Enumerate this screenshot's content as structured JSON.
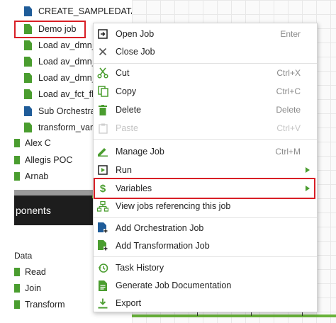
{
  "tree": {
    "items": [
      {
        "label": "CREATE_SAMPLEDATA_TABLE",
        "icon": "blue-file-icon",
        "color": "#1f5c99"
      },
      {
        "label": "Demo job",
        "icon": "green-file-icon",
        "color": "#4a9d2f"
      },
      {
        "label": "Load av_dmn_air",
        "icon": "green-file-icon",
        "color": "#4a9d2f"
      },
      {
        "label": "Load av_dmn_air",
        "icon": "green-file-icon",
        "color": "#4a9d2f"
      },
      {
        "label": "Load av_dmn_dat",
        "icon": "green-file-icon",
        "color": "#4a9d2f"
      },
      {
        "label": "Load av_fct_fligh",
        "icon": "green-file-icon",
        "color": "#4a9d2f"
      },
      {
        "label": "Sub Orchestration",
        "icon": "blue-file-icon",
        "color": "#1f5c99"
      },
      {
        "label": "transform_variab",
        "icon": "green-file-icon",
        "color": "#4a9d2f"
      }
    ],
    "folders": [
      "Alex C",
      "Allegis POC",
      "Arnab"
    ]
  },
  "components_panel": {
    "title": "ponents",
    "section": "Data",
    "items": [
      "Read",
      "Join",
      "Transform"
    ]
  },
  "context_menu": {
    "items": [
      {
        "label": "Open Job",
        "shortcut": "Enter",
        "icon": "open-job-icon",
        "disabled": false
      },
      {
        "label": "Close Job",
        "shortcut": "",
        "icon": "close-icon",
        "disabled": false
      },
      {
        "label": "Cut",
        "shortcut": "Ctrl+X",
        "icon": "scissors-icon",
        "disabled": false
      },
      {
        "label": "Copy",
        "shortcut": "Ctrl+C",
        "icon": "copy-icon",
        "disabled": false
      },
      {
        "label": "Delete",
        "shortcut": "Delete",
        "icon": "trash-icon",
        "disabled": false
      },
      {
        "label": "Paste",
        "shortcut": "Ctrl+V",
        "icon": "paste-icon",
        "disabled": true
      },
      {
        "label": "Manage Job",
        "shortcut": "Ctrl+M",
        "icon": "pencil-icon",
        "disabled": false
      },
      {
        "label": "Run",
        "shortcut": "",
        "icon": "run-icon",
        "disabled": false,
        "submenu": true
      },
      {
        "label": "Variables",
        "shortcut": "",
        "icon": "dollar-icon",
        "disabled": false,
        "submenu": true
      },
      {
        "label": "View jobs referencing this job",
        "shortcut": "",
        "icon": "hierarchy-icon",
        "disabled": false
      },
      {
        "label": "Add Orchestration Job",
        "shortcut": "",
        "icon": "add-orchestration-icon",
        "disabled": false
      },
      {
        "label": "Add Transformation Job",
        "shortcut": "",
        "icon": "add-transformation-icon",
        "disabled": false
      },
      {
        "label": "Task History",
        "shortcut": "",
        "icon": "history-icon",
        "disabled": false
      },
      {
        "label": "Generate Job Documentation",
        "shortcut": "",
        "icon": "document-icon",
        "disabled": false
      },
      {
        "label": "Export",
        "shortcut": "",
        "icon": "export-icon",
        "disabled": false
      }
    ]
  },
  "colors": {
    "accent_green": "#4a9d2f",
    "accent_blue": "#1f5c99",
    "highlight_red": "#d81f26"
  }
}
